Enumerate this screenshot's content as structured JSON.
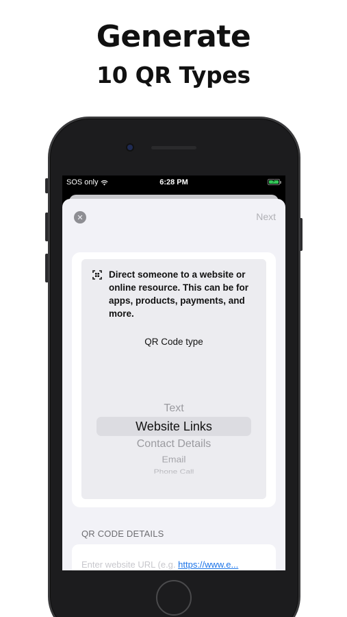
{
  "headline": {
    "line1": "Generate",
    "line2": "10 QR Types"
  },
  "status_bar": {
    "carrier": "SOS only",
    "time": "6:28 PM",
    "battery_color": "#34c759"
  },
  "sheet": {
    "close_icon": "close-icon",
    "next_label": "Next",
    "description": "Direct someone to a website or online resource. This can be for apps, products, payments, and more.",
    "type_label": "QR Code type",
    "picker_options": [
      "Text",
      "Website Links",
      "Contact Details",
      "Email",
      "Phone Call"
    ],
    "selected_option": "Website Links",
    "details_header": "QR CODE DETAILS",
    "url_placeholder": "Enter website URL (e.g. ",
    "url_example": "https://www.e..."
  },
  "colors": {
    "sheet_bg": "#f2f2f7",
    "link": "#1a73e8"
  }
}
